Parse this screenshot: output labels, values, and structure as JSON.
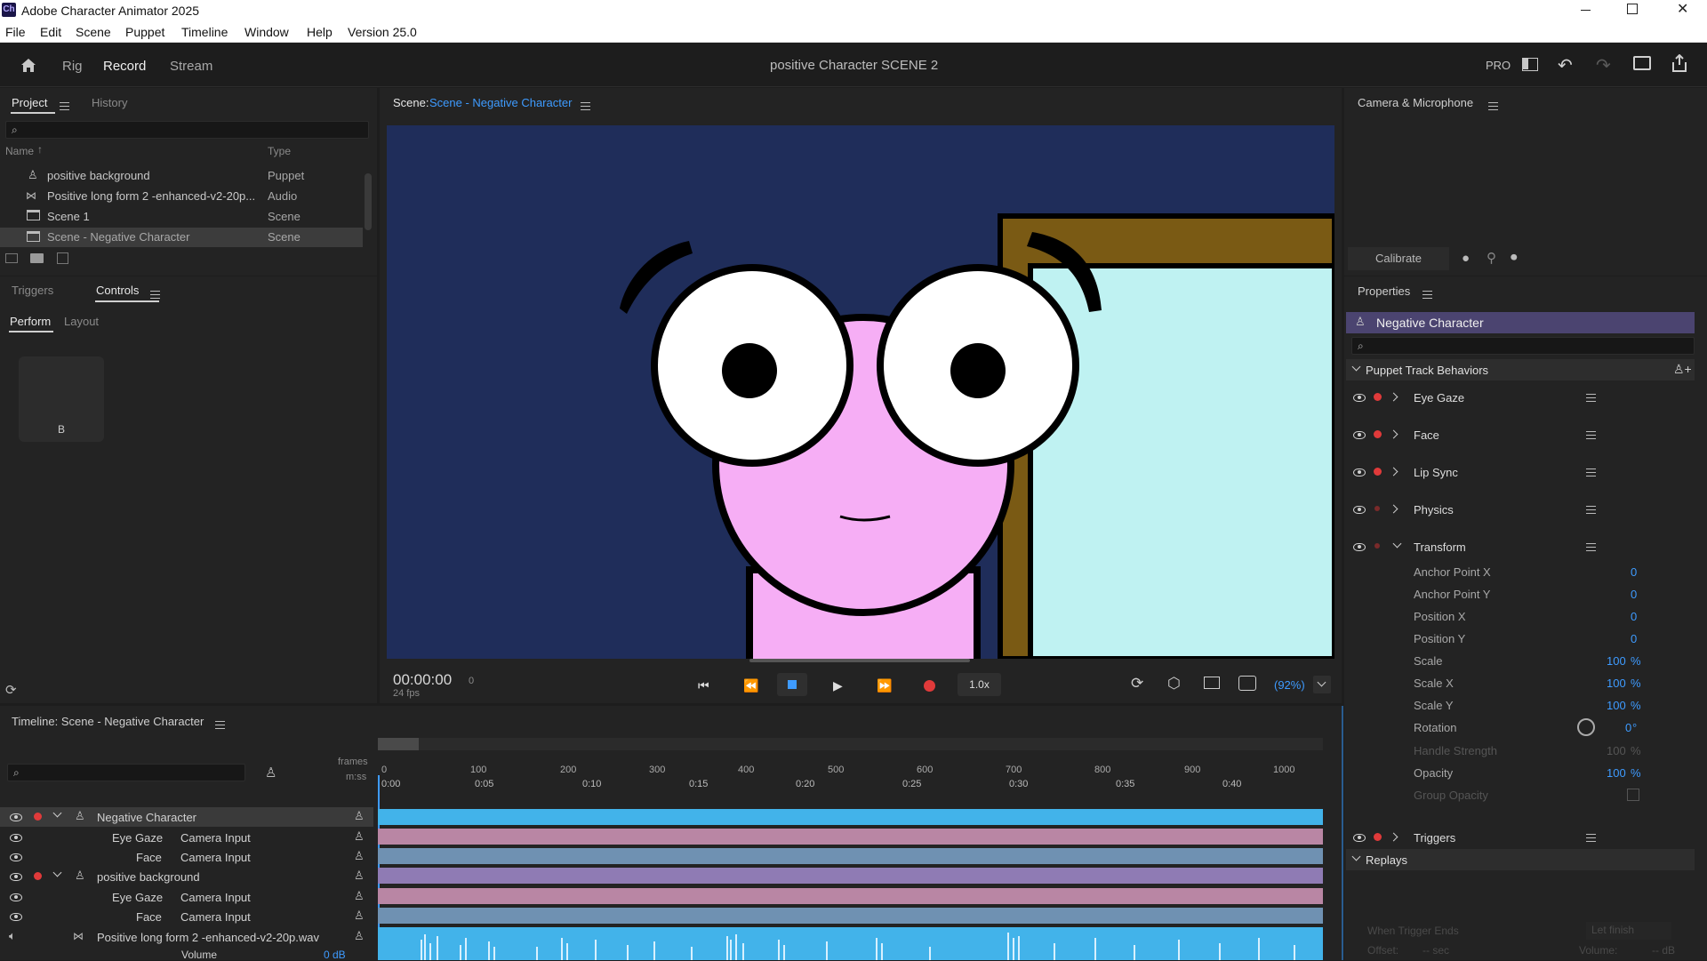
{
  "window": {
    "title": "Adobe Character Animator 2025",
    "app_badge": "Ch"
  },
  "menu": [
    "File",
    "Edit",
    "Scene",
    "Puppet",
    "Timeline",
    "Window",
    "Help",
    "Version 25.0"
  ],
  "workspace": {
    "tabs": [
      "Rig",
      "Record",
      "Stream"
    ],
    "active": "Record",
    "scene_title": "positive Character SCENE 2",
    "pro_label": "PRO"
  },
  "project": {
    "tabs": [
      "Project",
      "History"
    ],
    "columns": [
      "Name",
      "Type"
    ],
    "items": [
      {
        "name": "positive background",
        "type": "Puppet"
      },
      {
        "name": "Positive long form 2 -enhanced-v2-20p...",
        "type": "Audio"
      },
      {
        "name": "Scene 1",
        "type": "Scene"
      },
      {
        "name": "Scene - Negative Character",
        "type": "Scene"
      }
    ]
  },
  "controls": {
    "tabs": [
      "Triggers",
      "Controls"
    ],
    "subtabs": [
      "Perform",
      "Layout"
    ],
    "trigger_key": "B"
  },
  "scene": {
    "label": "Scene:",
    "name": "Scene - Negative Character",
    "timecode": "00:00:00",
    "frame": "0",
    "fps": "24 fps",
    "speed": "1.0x",
    "zoom": "(92%)"
  },
  "camera": {
    "title": "Camera & Microphone",
    "calibrate": "Calibrate"
  },
  "properties": {
    "title": "Properties",
    "puppet": "Negative Character",
    "section": "Puppet Track Behaviors",
    "behaviors": [
      "Eye Gaze",
      "Face",
      "Lip Sync",
      "Physics",
      "Transform"
    ],
    "transform": [
      {
        "label": "Anchor Point X",
        "value": "0",
        "unit": ""
      },
      {
        "label": "Anchor Point Y",
        "value": "0",
        "unit": ""
      },
      {
        "label": "Position X",
        "value": "0",
        "unit": ""
      },
      {
        "label": "Position Y",
        "value": "0",
        "unit": ""
      },
      {
        "label": "Scale",
        "value": "100",
        "unit": "%"
      },
      {
        "label": "Scale X",
        "value": "100",
        "unit": "%"
      },
      {
        "label": "Scale Y",
        "value": "100",
        "unit": "%"
      },
      {
        "label": "Rotation",
        "value": "0",
        "unit": "°"
      },
      {
        "label": "Handle Strength",
        "value": "100",
        "unit": "%"
      },
      {
        "label": "Opacity",
        "value": "100",
        "unit": "%"
      },
      {
        "label": "Group Opacity",
        "value": "",
        "unit": ""
      }
    ],
    "triggers": "Triggers",
    "replays": "Replays",
    "when_trigger_ends": "When Trigger Ends",
    "let_finish": "Let finish",
    "offset": "Offset:",
    "offset_val": "-- sec",
    "volume": "Volume:",
    "volume_val": "-- dB"
  },
  "timeline": {
    "title": "Timeline: Scene - Negative Character",
    "frames_label": "frames",
    "mss_label": "m:ss",
    "frame_ticks": [
      "0",
      "100",
      "200",
      "300",
      "400",
      "500",
      "600",
      "700",
      "800",
      "900",
      "1000"
    ],
    "time_ticks": [
      "0:00",
      "0:05",
      "0:10",
      "0:15",
      "0:20",
      "0:25",
      "0:30",
      "0:35",
      "0:40"
    ],
    "tracks": [
      {
        "name": "Negative Character",
        "source": ""
      },
      {
        "name": "Eye Gaze",
        "source": "Camera Input"
      },
      {
        "name": "Face",
        "source": "Camera Input"
      },
      {
        "name": "positive background",
        "source": ""
      },
      {
        "name": "Eye Gaze",
        "source": "Camera Input"
      },
      {
        "name": "Face",
        "source": "Camera Input"
      },
      {
        "name": "Positive long form 2 -enhanced-v2-20p.wav",
        "source": ""
      }
    ],
    "volume_label": "Volume",
    "volume_value": "0 dB"
  },
  "colors": {
    "accent": "#3e9bff",
    "record": "#e03a3a",
    "scene_bg": "#1f2d5a",
    "face": "#f6aef5",
    "wall": "#bff2f2",
    "frame": "#7a5a14"
  }
}
